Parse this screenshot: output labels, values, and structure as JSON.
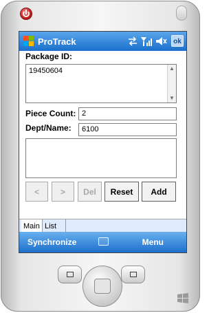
{
  "app": {
    "title": "ProTrack"
  },
  "status_icons": [
    "sync-icon",
    "signal-icon",
    "volume-icon"
  ],
  "title_bar": {
    "ok_label": "ok"
  },
  "form": {
    "package_id_label": "Package ID:",
    "package_id_value": "19450604",
    "piece_count_label": "Piece Count:",
    "piece_count_value": "2",
    "dept_name_label": "Dept/Name:",
    "dept_name_value": "6100",
    "notes_value": ""
  },
  "buttons": {
    "prev": "<",
    "next": ">",
    "del": "Del",
    "reset": "Reset",
    "add": "Add"
  },
  "tabs": [
    {
      "label": "Main"
    },
    {
      "label": "List"
    }
  ],
  "menu_bar": {
    "left": "Synchronize",
    "right": "Menu"
  },
  "colors": {
    "title_bar": "#1a6fcb",
    "menu_bar": "#1b6fcb"
  }
}
